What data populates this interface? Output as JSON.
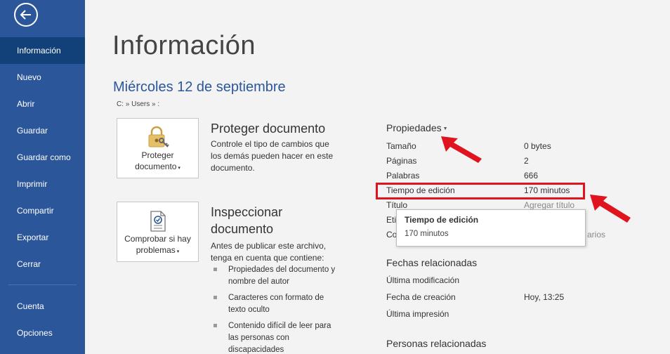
{
  "sidebar": {
    "items": [
      {
        "label": "Información",
        "active": true
      },
      {
        "label": "Nuevo"
      },
      {
        "label": "Abrir"
      },
      {
        "label": "Guardar"
      },
      {
        "label": "Guardar como"
      },
      {
        "label": "Imprimir"
      },
      {
        "label": "Compartir"
      },
      {
        "label": "Exportar"
      },
      {
        "label": "Cerrar"
      },
      {
        "label": "Cuenta"
      },
      {
        "label": "Opciones"
      }
    ],
    "accent": "#2b579a",
    "active_bg": "#124078"
  },
  "main": {
    "title": "Información",
    "doc_name": "Miércoles 12 de septiembre",
    "doc_path": "C: » Users » :",
    "protect": {
      "button_line1": "Proteger",
      "button_line2": "documento",
      "title": "Proteger documento",
      "desc": "Controle el tipo de cambios que los demás pueden hacer en este documento."
    },
    "inspect": {
      "button_line1": "Comprobar si hay",
      "button_line2": "problemas",
      "title_line1": "Inspeccionar",
      "title_line2": "documento",
      "desc": "Antes de publicar este archivo, tenga en cuenta que contiene:",
      "bullets": [
        "Propiedades del documento y nombre del autor",
        "Caracteres con formato de texto oculto",
        "Contenido difícil de leer para las personas con discapacidades"
      ]
    }
  },
  "properties": {
    "header": "Propiedades",
    "rows": [
      {
        "key": "Tamaño",
        "value": "0 bytes"
      },
      {
        "key": "Páginas",
        "value": "2"
      },
      {
        "key": "Palabras",
        "value": "666"
      },
      {
        "key": "Tiempo de edición",
        "value": "170 minutos"
      },
      {
        "key": "Título",
        "value": "Agregar título"
      },
      {
        "key": "Eti",
        "value": ""
      },
      {
        "key": "Co",
        "value": "arios"
      }
    ],
    "tooltip": {
      "title": "Tiempo de edición",
      "value": "170 minutos"
    }
  },
  "related_dates": {
    "header": "Fechas relacionadas",
    "rows": [
      {
        "key": "Última modificación",
        "value": ""
      },
      {
        "key": "Fecha de creación",
        "value": "Hoy, 13:25"
      },
      {
        "key": "Última impresión",
        "value": ""
      }
    ]
  },
  "related_people": {
    "header": "Personas relacionadas"
  },
  "highlight_color": "#e0141e"
}
